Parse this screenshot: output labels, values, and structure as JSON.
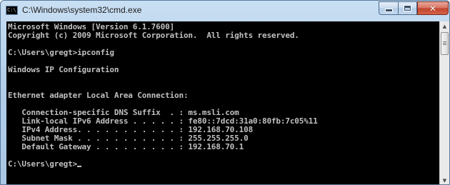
{
  "window": {
    "title": "C:\\Windows\\system32\\cmd.exe",
    "icon": "console-icon",
    "icon_glyph": "C:\\"
  },
  "caption_buttons": {
    "minimize_icon": "minimize-icon",
    "maximize_icon": "maximize-icon",
    "close_icon": "close-icon",
    "close_glyph": "✕"
  },
  "console": {
    "lines": [
      "Microsoft Windows [Version 6.1.7600]",
      "Copyright (c) 2009 Microsoft Corporation.  All rights reserved.",
      "",
      "C:\\Users\\gregt>ipconfig",
      "",
      "Windows IP Configuration",
      "",
      "",
      "Ethernet adapter Local Area Connection:",
      "",
      "   Connection-specific DNS Suffix  . : ms.msli.com",
      "   Link-local IPv6 Address . . . . . : fe80::7dcd:31a0:80fb:7c05%11",
      "   IPv4 Address. . . . . . . . . . . : 192.168.70.108",
      "   Subnet Mask . . . . . . . . . . . : 255.255.255.0",
      "   Default Gateway . . . . . . . . . : 192.168.70.1",
      "",
      "C:\\Users\\gregt>"
    ]
  },
  "scrollbar": {
    "up_glyph": "▲",
    "down_glyph": "▼"
  },
  "colors": {
    "console_background": "#000000",
    "console_text": "#c0c0c0",
    "close_button": "#c2432c"
  }
}
